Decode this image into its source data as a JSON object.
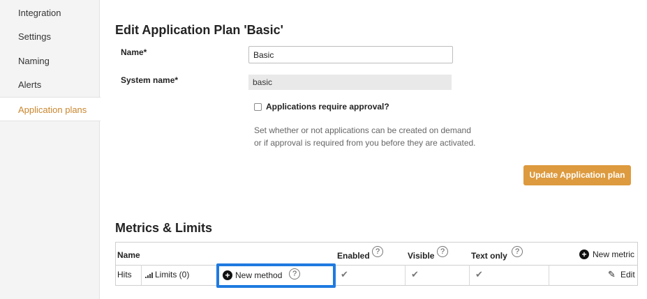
{
  "sidebar": {
    "items": [
      {
        "label": "Integration"
      },
      {
        "label": "Settings"
      },
      {
        "label": "Naming"
      },
      {
        "label": "Alerts"
      },
      {
        "label": "Application plans"
      }
    ]
  },
  "form": {
    "title": "Edit Application Plan 'Basic'",
    "name_label": "Name*",
    "name_value": "Basic",
    "system_name_label": "System name*",
    "system_name_value": "basic",
    "approval_label": "Applications require approval?",
    "approval_checked": false,
    "hint_line1": "Set whether or not applications can be created on demand",
    "hint_line2": "or if approval is required from you before they are activated.",
    "submit_label": "Update Application plan"
  },
  "metrics": {
    "title": "Metrics & Limits",
    "columns": {
      "name": "Name",
      "enabled": "Enabled",
      "visible": "Visible",
      "text_only": "Text only",
      "new_metric": "New metric",
      "help_glyph": "?"
    },
    "rows": [
      {
        "name": "Hits",
        "limits": "Limits (0)",
        "new_method": "New method",
        "enabled_glyph": "✔",
        "visible_glyph": "✔",
        "text_only_glyph": "✔",
        "edit": "Edit"
      }
    ]
  },
  "colors": {
    "accent": "#dd9a3e",
    "active_nav": "#c9862e",
    "highlight": "#1f7ae0"
  }
}
